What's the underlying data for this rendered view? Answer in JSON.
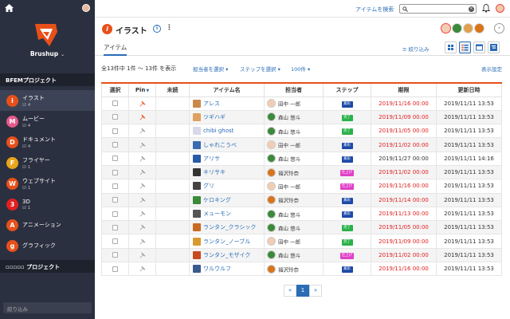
{
  "sidebar": {
    "brand": "Brushup",
    "bfem_header": "BFEMプロジェクト",
    "other_header": "▫▫▫▫▫ プロジェクト",
    "filter_placeholder": "絞り込み",
    "items": [
      {
        "letter": "i",
        "label": "イラスト",
        "count": "4",
        "color": "#e8501a",
        "active": true
      },
      {
        "letter": "M",
        "label": "ムービー",
        "count": "4",
        "color": "#e55a8a"
      },
      {
        "letter": "D",
        "label": "ドキュメント",
        "count": "4",
        "color": "#e8501a"
      },
      {
        "letter": "F",
        "label": "フライヤー",
        "count": "1",
        "color": "#e8a61a"
      },
      {
        "letter": "W",
        "label": "ウェブサイト",
        "count": "1",
        "color": "#e8501a"
      },
      {
        "letter": "3",
        "label": "3D",
        "count": "1",
        "color": "#e02020"
      },
      {
        "letter": "A",
        "label": "アニメーション",
        "count": "",
        "color": "#e8501a"
      },
      {
        "letter": "g",
        "label": "グラフィック",
        "count": "",
        "color": "#e8501a"
      }
    ]
  },
  "topbar": {
    "search_link": "アイテムを検索"
  },
  "header": {
    "title": "イラスト",
    "info": "i",
    "more": "⋮",
    "next": "›"
  },
  "tabs": {
    "items_tab": "アイテム",
    "filter": "≡ 絞り込み"
  },
  "toolbar": {
    "count_text": "全13件中 1件 〜 13件 を表示",
    "assignee_select": "担当者を選択 ▾",
    "step_select": "ステップを選択 ▾",
    "per_page": "100件 ▾",
    "display_settings": "表示設定"
  },
  "table": {
    "headers": [
      "選択",
      "Pin",
      "未読",
      "アイテム名",
      "担当者",
      "ステップ",
      "期限",
      "更新日時"
    ],
    "rows": [
      {
        "pinned": true,
        "name": "アレス",
        "user": "田中 一郎",
        "ucolor": "#f3cdb3",
        "step": "素彩",
        "scolor": "#1d4aa8",
        "due": "2019/11/16 00:00",
        "due_red": true,
        "updated": "2019/11/11 13:53",
        "thumb": "#c88a4a"
      },
      {
        "pinned": true,
        "name": "ツギハギ",
        "user": "森山 悠斗",
        "ucolor": "#3a8a3a",
        "step": "完了",
        "scolor": "#2ab24a",
        "due": "2019/11/09 00:00",
        "due_red": true,
        "updated": "2019/11/11 13:53",
        "thumb": "#e0a060"
      },
      {
        "pinned": false,
        "name": "chibi ghost",
        "user": "森山 悠斗",
        "ucolor": "#3a8a3a",
        "step": "完了",
        "scolor": "#2ab24a",
        "due": "2019/11/05 00:00",
        "due_red": true,
        "updated": "2019/11/11 13:53",
        "thumb": "#d8d8e8"
      },
      {
        "pinned": false,
        "name": "しゃれこうべ",
        "user": "田中 一郎",
        "ucolor": "#f3cdb3",
        "step": "素彩",
        "scolor": "#1d4aa8",
        "due": "2019/11/02 00:00",
        "due_red": true,
        "updated": "2019/11/11 13:53",
        "thumb": "#3a6ab0"
      },
      {
        "pinned": false,
        "name": "アリサ",
        "user": "森山 悠斗",
        "ucolor": "#3a8a3a",
        "step": "素彩",
        "scolor": "#1d4aa8",
        "due": "2019/11/27 00:00",
        "due_red": false,
        "updated": "2019/11/11 14:16",
        "thumb": "#2a5aa8"
      },
      {
        "pinned": false,
        "name": "キリサキ",
        "user": "福沢玲奈",
        "ucolor": "#d8741a",
        "step": "仕上げ",
        "scolor": "#e040c8",
        "due": "2019/11/02 00:00",
        "due_red": true,
        "updated": "2019/11/11 13:53",
        "thumb": "#333"
      },
      {
        "pinned": false,
        "name": "グリ",
        "user": "田中 一郎",
        "ucolor": "#f3cdb3",
        "step": "仕上げ",
        "scolor": "#e040c8",
        "due": "2019/11/16 00:00",
        "due_red": true,
        "updated": "2019/11/11 13:53",
        "thumb": "#444"
      },
      {
        "pinned": false,
        "name": "ケロキング",
        "user": "福沢玲奈",
        "ucolor": "#d8741a",
        "step": "素彩",
        "scolor": "#1d4aa8",
        "due": "2019/11/14 00:00",
        "due_red": true,
        "updated": "2019/11/11 13:53",
        "thumb": "#3a8a3a"
      },
      {
        "pinned": false,
        "name": "メューモン",
        "user": "森山 悠斗",
        "ucolor": "#3a8a3a",
        "step": "素彩",
        "scolor": "#1d4aa8",
        "due": "2019/11/13 00:00",
        "due_red": true,
        "updated": "2019/11/11 13:53",
        "thumb": "#555"
      },
      {
        "pinned": false,
        "name": "ランタン_クラシック",
        "user": "森山 悠斗",
        "ucolor": "#3a8a3a",
        "step": "完了",
        "scolor": "#2ab24a",
        "due": "2019/11/05 00:00",
        "due_red": true,
        "updated": "2019/11/11 13:53",
        "thumb": "#c86a20"
      },
      {
        "pinned": false,
        "name": "ランタン_ノーブル",
        "user": "田中 一郎",
        "ucolor": "#f3cdb3",
        "step": "完了",
        "scolor": "#2ab24a",
        "due": "2019/11/09 00:00",
        "due_red": true,
        "updated": "2019/11/11 13:53",
        "thumb": "#d89a30"
      },
      {
        "pinned": false,
        "name": "ランタン_モザイク",
        "user": "森山 悠斗",
        "ucolor": "#3a8a3a",
        "step": "仕上げ",
        "scolor": "#e040c8",
        "due": "2019/11/02 00:00",
        "due_red": true,
        "updated": "2019/11/11 13:53",
        "thumb": "#c84a20"
      },
      {
        "pinned": false,
        "name": "ワルウルフ",
        "user": "福沢玲奈",
        "ucolor": "#d8741a",
        "step": "素彩",
        "scolor": "#1d4aa8",
        "due": "2019/11/16 00:00",
        "due_red": true,
        "updated": "2019/11/11 13:53",
        "thumb": "#3a5a90"
      }
    ]
  },
  "pagination": {
    "prev": "«",
    "current": "1",
    "next": "»"
  },
  "colors": {
    "accent": "#e8501a",
    "link": "#2a6db6",
    "sidebar_bg": "#2b3040"
  }
}
